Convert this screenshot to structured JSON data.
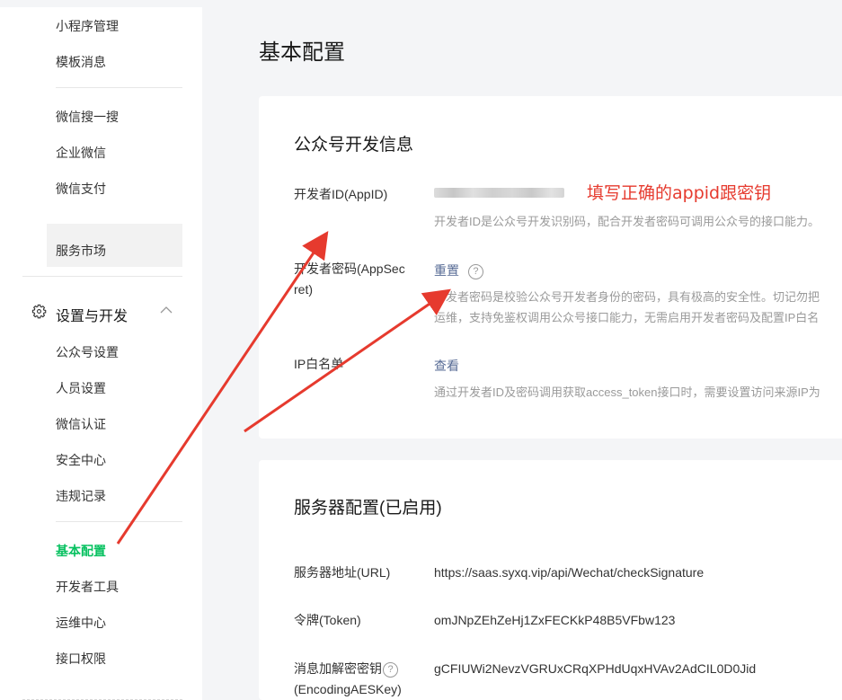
{
  "sidebar": {
    "items_top": [
      "小程序管理",
      "模板消息"
    ],
    "items_mid": [
      "微信搜一搜",
      "企业微信",
      "微信支付"
    ],
    "market": "服务市场",
    "section": {
      "label": "设置与开发",
      "icon": "gear-icon",
      "chevron": "chevron-up-icon"
    },
    "items_settings": [
      "公众号设置",
      "人员设置",
      "微信认证",
      "安全中心",
      "违规记录"
    ],
    "items_dev": [
      "基本配置",
      "开发者工具",
      "运维中心",
      "接口权限"
    ],
    "active_item": "基本配置",
    "accent_color": "#07c160"
  },
  "page_title": "基本配置",
  "dev_info": {
    "title": "公众号开发信息",
    "appid_label": "开发者ID(AppID)",
    "appid_desc": "开发者ID是公众号开发识别码，配合开发者密码可调用公众号的接口能力。",
    "secret_label_1": "开发者密码(AppSec",
    "secret_label_2": "ret)",
    "secret_action": "重置",
    "secret_help": "?",
    "secret_desc_1": "开发者密码是校验公众号开发者身份的密码，具有极高的安全性。切记勿把",
    "secret_desc_2": "运维，支持免鉴权调用公众号接口能力，无需启用开发者密码及配置IP白名",
    "ip_label": "IP白名单",
    "ip_action": "查看",
    "ip_desc": "通过开发者ID及密码调用获取access_token接口时，需要设置访问来源IP为"
  },
  "server_config": {
    "title": "服务器配置(已启用)",
    "url_label": "服务器地址(URL)",
    "url_value": "https://saas.syxq.vip/api/Wechat/checkSignature",
    "token_label": "令牌(Token)",
    "token_value": "omJNpZEhZeHj1ZxFECKkP48B5VFbw123",
    "aeskey_label_1": "消息加解密密钥",
    "aeskey_label_2": "(EncodingAESKey)",
    "aeskey_help": "?",
    "aeskey_value": "gCFIUWi2NevzVGRUxCRqXPHdUqxHVAv2AdCIL0D0Jid"
  },
  "annotation": {
    "text": "填写正确的appid跟密钥",
    "color": "#e63a2e"
  }
}
